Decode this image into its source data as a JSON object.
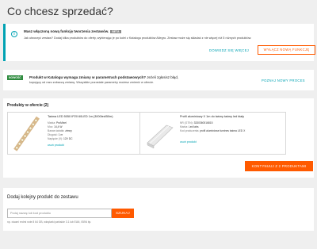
{
  "page": {
    "title": "Co chcesz sprzedać?"
  },
  "info_banner": {
    "title": "Masz włączoną nową funkcję tworzenia zestawów.",
    "badge": "BETA",
    "description": "Jak utworzyć zestaw? Dodaj kilka produktów do oferty, wybierając je po kolei z Katalogu produktów Allegro. Zestaw może się składać z nie więcej niż 5 różnych produktów.",
    "learn_more": "DOWIEDZ SIĘ WIĘCEJ",
    "disable_button": "WYŁĄCZ NOWĄ FUNKCJĘ"
  },
  "notice": {
    "badge": "NOWOŚĆ",
    "title_bold": "Produkt w Katalogu wymaga zmiany w parametrach podstawowych?",
    "title_rest": " Jeżeli zgłosisz błąd,",
    "text": "kupujący od razu zobaczą zmianę. Wszystkie pozostałe parametry możesz zmienić w ofercie.",
    "link": "POZNAJ NOWY PROCES"
  },
  "products": {
    "title": "Produkty w ofercie (2)",
    "items": [
      {
        "name": "Taśma LED 5050 IP20 60LED 1m (3000led/50m)",
        "attrs": [
          {
            "label": "Marka:",
            "value": "ProMixel"
          },
          {
            "label": "Moc:",
            "value": "14,4 W"
          },
          {
            "label": "Barwa światła:",
            "value": "zimny"
          },
          {
            "label": "Długość:",
            "value": "1 m"
          },
          {
            "label": "Napięcie (V):",
            "value": "12V DC"
          }
        ],
        "remove": "usuń produkt"
      },
      {
        "name": "Profil aluminiowy X 1m do taśmy taśmy led biały",
        "attrs": [
          {
            "label": "NR (GTIN):",
            "value": "3330360016815"
          },
          {
            "label": "Marka:",
            "value": "Led labs"
          },
          {
            "label": "Kod producenta:",
            "value": "profil aluminiowe lumines taśma LED X"
          }
        ],
        "remove": "usuń produkt"
      }
    ],
    "continue_button": "KONTYNUUJ Z 2 PRODUKTAMI"
  },
  "add_product": {
    "title": "Dodaj kolejny produkt do zestawu",
    "placeholder": "Podaj nazwę lub kod produktu",
    "search_button": "SZUKAJ",
    "hint": "np. xiaomi redmi note 8 64 GB, wkrętarki parkside 3.1 lub EAN, ISBN itp."
  },
  "colors": {
    "accent": "#ff5a00",
    "link": "#00a2b3",
    "new_badge": "#2e8b3e"
  }
}
